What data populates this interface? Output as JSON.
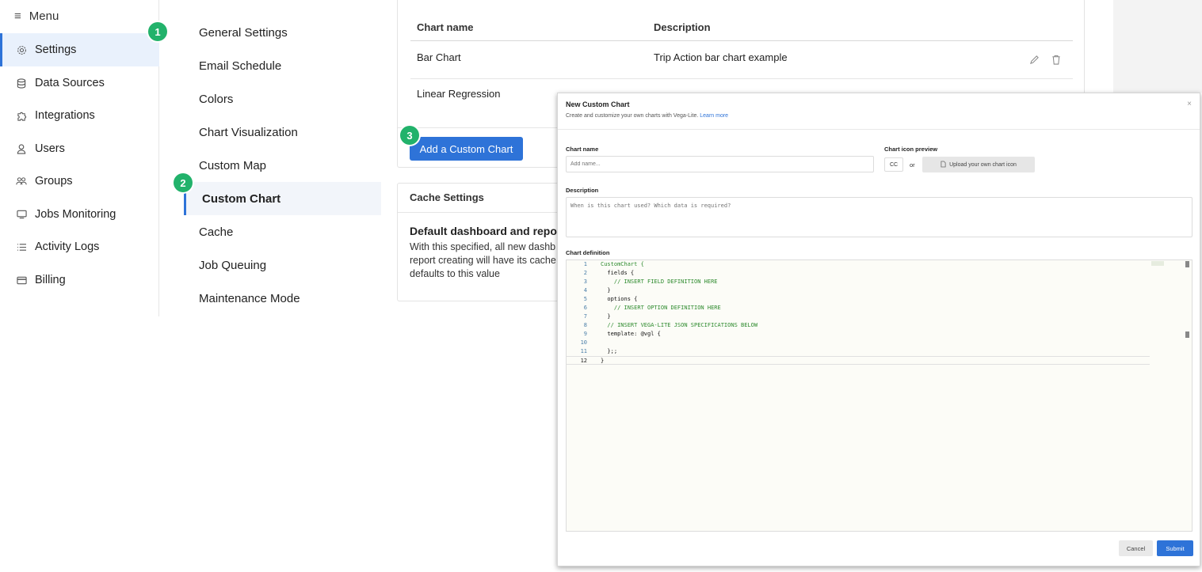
{
  "menu": {
    "header": "Menu",
    "items": [
      {
        "label": "Settings",
        "icon": "gear-icon"
      },
      {
        "label": "Data Sources",
        "icon": "database-icon"
      },
      {
        "label": "Integrations",
        "icon": "puzzle-icon"
      },
      {
        "label": "Users",
        "icon": "user-icon"
      },
      {
        "label": "Groups",
        "icon": "group-icon"
      },
      {
        "label": "Jobs Monitoring",
        "icon": "monitor-icon"
      },
      {
        "label": "Activity Logs",
        "icon": "list-icon"
      },
      {
        "label": "Billing",
        "icon": "card-icon"
      }
    ]
  },
  "badges": [
    "1",
    "2",
    "3"
  ],
  "settings_submenu": [
    "General Settings",
    "Email Schedule",
    "Colors",
    "Chart Visualization",
    "Custom Map",
    "Custom Chart",
    "Cache",
    "Job Queuing",
    "Maintenance Mode"
  ],
  "charts_table": {
    "headers": [
      "Chart name",
      "Description"
    ],
    "rows": [
      {
        "name": "Bar Chart",
        "description": "Trip Action bar chart example"
      },
      {
        "name": "Linear Regression",
        "description": ""
      }
    ],
    "add_button": "Add a Custom Chart"
  },
  "cache_card": {
    "title": "Cache Settings",
    "heading": "Default dashboard and report",
    "body_lines": [
      "With this specified, all new dashb",
      "report creating will have its cache",
      "defaults to this value"
    ]
  },
  "modal": {
    "title": "New Custom Chart",
    "subtitle": "Create and customize your own charts with Vega-Lite.",
    "learn_more": "Learn more",
    "close": "×",
    "chart_name_label": "Chart name",
    "chart_name_placeholder": "Add name...",
    "icon_preview_label": "Chart icon preview",
    "icon_preview_value": "CC",
    "or_text": "or",
    "upload_label": "Upload your own chart icon",
    "description_label": "Description",
    "description_placeholder": "When is this chart used? Which data is required?",
    "definition_label": "Chart definition",
    "code_lines": [
      {
        "n": "1",
        "text": "CustomChart {"
      },
      {
        "n": "2",
        "text": "  fields {"
      },
      {
        "n": "3",
        "text": "    // INSERT FIELD DEFINITION HERE"
      },
      {
        "n": "4",
        "text": "  }"
      },
      {
        "n": "5",
        "text": "  options {"
      },
      {
        "n": "6",
        "text": "    // INSERT OPTION DEFINITION HERE"
      },
      {
        "n": "7",
        "text": "  }"
      },
      {
        "n": "8",
        "text": "  // INSERT VEGA-LITE JSON SPECIFICATIONS BELOW"
      },
      {
        "n": "9",
        "text": "  template: @vgl {"
      },
      {
        "n": "10",
        "text": ""
      },
      {
        "n": "11",
        "text": "  };;"
      },
      {
        "n": "12",
        "text": "}"
      }
    ],
    "cancel": "Cancel",
    "submit": "Submit"
  }
}
